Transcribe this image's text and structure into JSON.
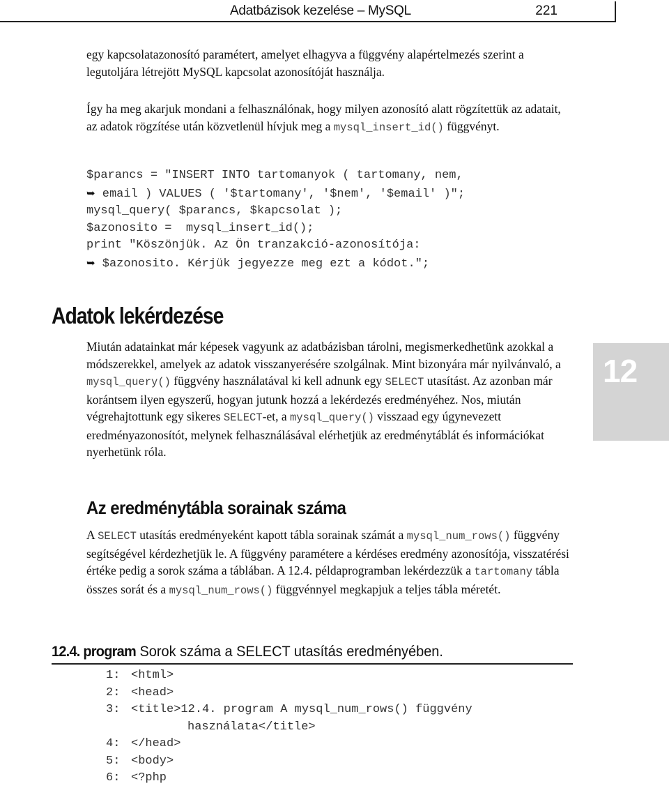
{
  "header": {
    "title": "Adatbázisok kezelése – MySQL",
    "page_number": "221"
  },
  "paragraph1": "egy kapcsolatazonosító paramétert, amelyet elhagyva a függvény alapértelmezés szerint a legutoljára létrejött MySQL kapcsolat azonosítóját használja.",
  "paragraph2": {
    "before": "Így ha meg akarjuk mondani a felhasználónak, hogy milyen azonosító alatt rögzítettük az adatait, az adatok rögzítése után közvetlenül hívjuk meg a ",
    "code": "mysql_insert_id()",
    "after": " függvényt."
  },
  "code_block": {
    "continuation_icon": "➥",
    "lines": [
      "$parancs = \"INSERT INTO tartomanyok ( tartomany, nem,",
      " email ) VALUES ( '$tartomany', '$nem', '$email' )\";",
      "mysql_query( $parancs, $kapcsolat );",
      "$azonosito =  mysql_insert_id();",
      "print \"Köszönjük. Az Ön tranzakció-azonosítója:",
      " $azonosito. Kérjük jegyezze meg ezt a kódot.\";"
    ]
  },
  "section1": {
    "heading": "Adatok lekérdezése",
    "body": [
      {
        "t": "Miután adatainkat már képesek vagyunk az adatbázisban tárolni, megismerkedhetünk azokkal a módszerekkel, amelyek az adatok visszanyerésére szolgálnak. Mint bizonyára már nyilvánvaló, a "
      },
      {
        "c": "mysql_query()"
      },
      {
        "t": " függvény használatával ki kell adnunk egy "
      },
      {
        "c": "SELECT"
      },
      {
        "t": " utasítást. Az azonban már korántsem ilyen egyszerű, hogyan jutunk hozzá a lekérdezés eredményéhez. Nos, miután végrehajtottunk egy sikeres "
      },
      {
        "c": "SELECT"
      },
      {
        "t": "-et, a "
      },
      {
        "c": "mysql_query()"
      },
      {
        "t": " visszaad egy úgynevezett eredményazonosítót, melynek felhasználásával elérhetjük az eredménytáblát és információkat nyerhetünk róla."
      }
    ]
  },
  "chapter_tab": {
    "number": "12",
    "color": "#d4d4d4"
  },
  "section2": {
    "heading": "Az eredménytábla sorainak száma",
    "body": [
      {
        "t": "A "
      },
      {
        "c": "SELECT"
      },
      {
        "t": " utasítás eredményeként kapott tábla sorainak számát a "
      },
      {
        "c": "mysql_num_rows()"
      },
      {
        "t": " függvény segítségével kérdezhetjük le. A függvény paramétere a kérdéses eredmény azonosítója, visszatérési értéke pedig a sorok száma a táblában. A 12.4. példaprogramban lekérdezzük a "
      },
      {
        "c": "tartomany"
      },
      {
        "t": " tábla összes sorát és a "
      },
      {
        "c": "mysql_num_rows()"
      },
      {
        "t": " függvénnyel megkapjuk a teljes tábla méretét."
      }
    ]
  },
  "listing": {
    "label": "12.4. program",
    "caption": " Sorok száma a SELECT utasítás eredményében.",
    "lines": [
      {
        "n": "1:",
        "code": "<html>"
      },
      {
        "n": "2:",
        "code": "<head>"
      },
      {
        "n": "3:",
        "code": "<title>12.4. program A mysql_num_rows() függvény"
      },
      {
        "n": "",
        "code": "használata</title>"
      },
      {
        "n": "4:",
        "code": "</head>"
      },
      {
        "n": "5:",
        "code": "<body>"
      },
      {
        "n": "6:",
        "code": "<?php"
      }
    ]
  }
}
